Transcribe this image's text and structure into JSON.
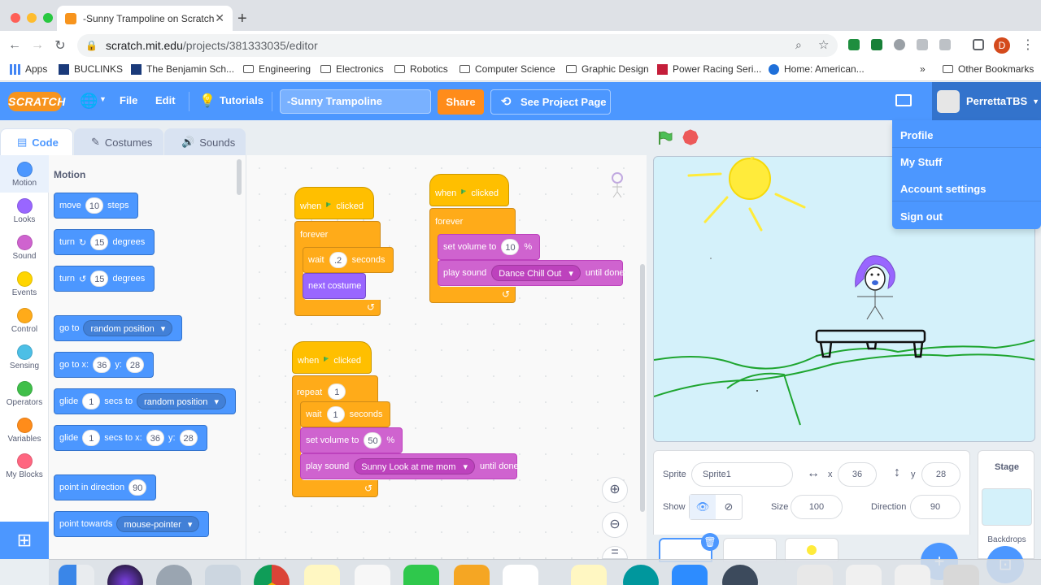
{
  "browser": {
    "tab_title": "-Sunny Trampoline on Scratch",
    "url_host": "scratch.mit.edu",
    "url_path": "/projects/381333035/editor",
    "profile_initial": "D",
    "bookmarks": [
      {
        "label": "Apps"
      },
      {
        "label": "BUCLINKS"
      },
      {
        "label": "The Benjamin Sch..."
      },
      {
        "label": "Engineering"
      },
      {
        "label": "Electronics"
      },
      {
        "label": "Robotics"
      },
      {
        "label": "Computer Science"
      },
      {
        "label": "Graphic Design"
      },
      {
        "label": "Power Racing Seri..."
      },
      {
        "label": "Home: American..."
      }
    ],
    "other_bookmarks": "Other Bookmarks",
    "overflow": "»"
  },
  "menubar": {
    "logo": "SCRATCH",
    "file": "File",
    "edit": "Edit",
    "tutorials": "Tutorials",
    "project_title": "-Sunny Trampoline",
    "share": "Share",
    "see_project": "See Project Page",
    "username": "PerrettaTBS"
  },
  "account_menu": {
    "items": [
      "Profile",
      "My Stuff",
      "Account settings",
      "Sign out"
    ]
  },
  "editor_tabs": {
    "code": "Code",
    "costumes": "Costumes",
    "sounds": "Sounds"
  },
  "categories": [
    {
      "label": "Motion",
      "color": "#4c97ff"
    },
    {
      "label": "Looks",
      "color": "#9966ff"
    },
    {
      "label": "Sound",
      "color": "#cf63cf"
    },
    {
      "label": "Events",
      "color": "#ffd500"
    },
    {
      "label": "Control",
      "color": "#ffab19"
    },
    {
      "label": "Sensing",
      "color": "#4cbfe6"
    },
    {
      "label": "Operators",
      "color": "#40bf4a"
    },
    {
      "label": "Variables",
      "color": "#ff8c1a"
    },
    {
      "label": "My Blocks",
      "color": "#ff6680"
    }
  ],
  "palette": {
    "heading": "Motion",
    "move": {
      "a": "move",
      "n": "10",
      "b": "steps"
    },
    "turn_cw": {
      "a": "turn",
      "n": "15",
      "b": "degrees"
    },
    "turn_ccw": {
      "a": "turn",
      "n": "15",
      "b": "degrees"
    },
    "goto": {
      "a": "go to",
      "d": "random position"
    },
    "gotoxy": {
      "a": "go to x:",
      "x": "36",
      "b": "y:",
      "y": "28"
    },
    "glide": {
      "a": "glide",
      "n": "1",
      "b": "secs to",
      "d": "random position"
    },
    "glidexy": {
      "a": "glide",
      "n": "1",
      "b": "secs to x:",
      "x": "36",
      "c": "y:",
      "y": "28"
    },
    "point_dir": {
      "a": "point in direction",
      "n": "90"
    },
    "point_towards": {
      "a": "point towards",
      "d": "mouse-pointer"
    }
  },
  "scripts": {
    "s1": {
      "hat_a": "when",
      "hat_b": "clicked",
      "forever": "forever",
      "wait_a": "wait",
      "wait_n": ".2",
      "wait_b": "seconds",
      "next_costume": "next costume"
    },
    "s2": {
      "hat_a": "when",
      "hat_b": "clicked",
      "forever": "forever",
      "vol_a": "set volume to",
      "vol_n": "10",
      "vol_b": "%",
      "play_a": "play sound",
      "play_d": "Dance Chill Out",
      "play_b": "until done"
    },
    "s3": {
      "hat_a": "when",
      "hat_b": "clicked",
      "repeat_a": "repeat",
      "repeat_n": "1",
      "wait_a": "wait",
      "wait_n": "1",
      "wait_b": "seconds",
      "vol_a": "set volume to",
      "vol_n": "50",
      "vol_b": "%",
      "play_a": "play sound",
      "play_d": "Sunny Look at me mom",
      "play_b": "until done"
    }
  },
  "sprite_info": {
    "sprite_label": "Sprite",
    "sprite_name": "Sprite1",
    "x_label": "x",
    "x": "36",
    "y_label": "y",
    "y": "28",
    "show_label": "Show",
    "size_label": "Size",
    "size": "100",
    "direction_label": "Direction",
    "direction": "90"
  },
  "stage_pane": {
    "label": "Stage",
    "backdrops": "Backdrops"
  }
}
